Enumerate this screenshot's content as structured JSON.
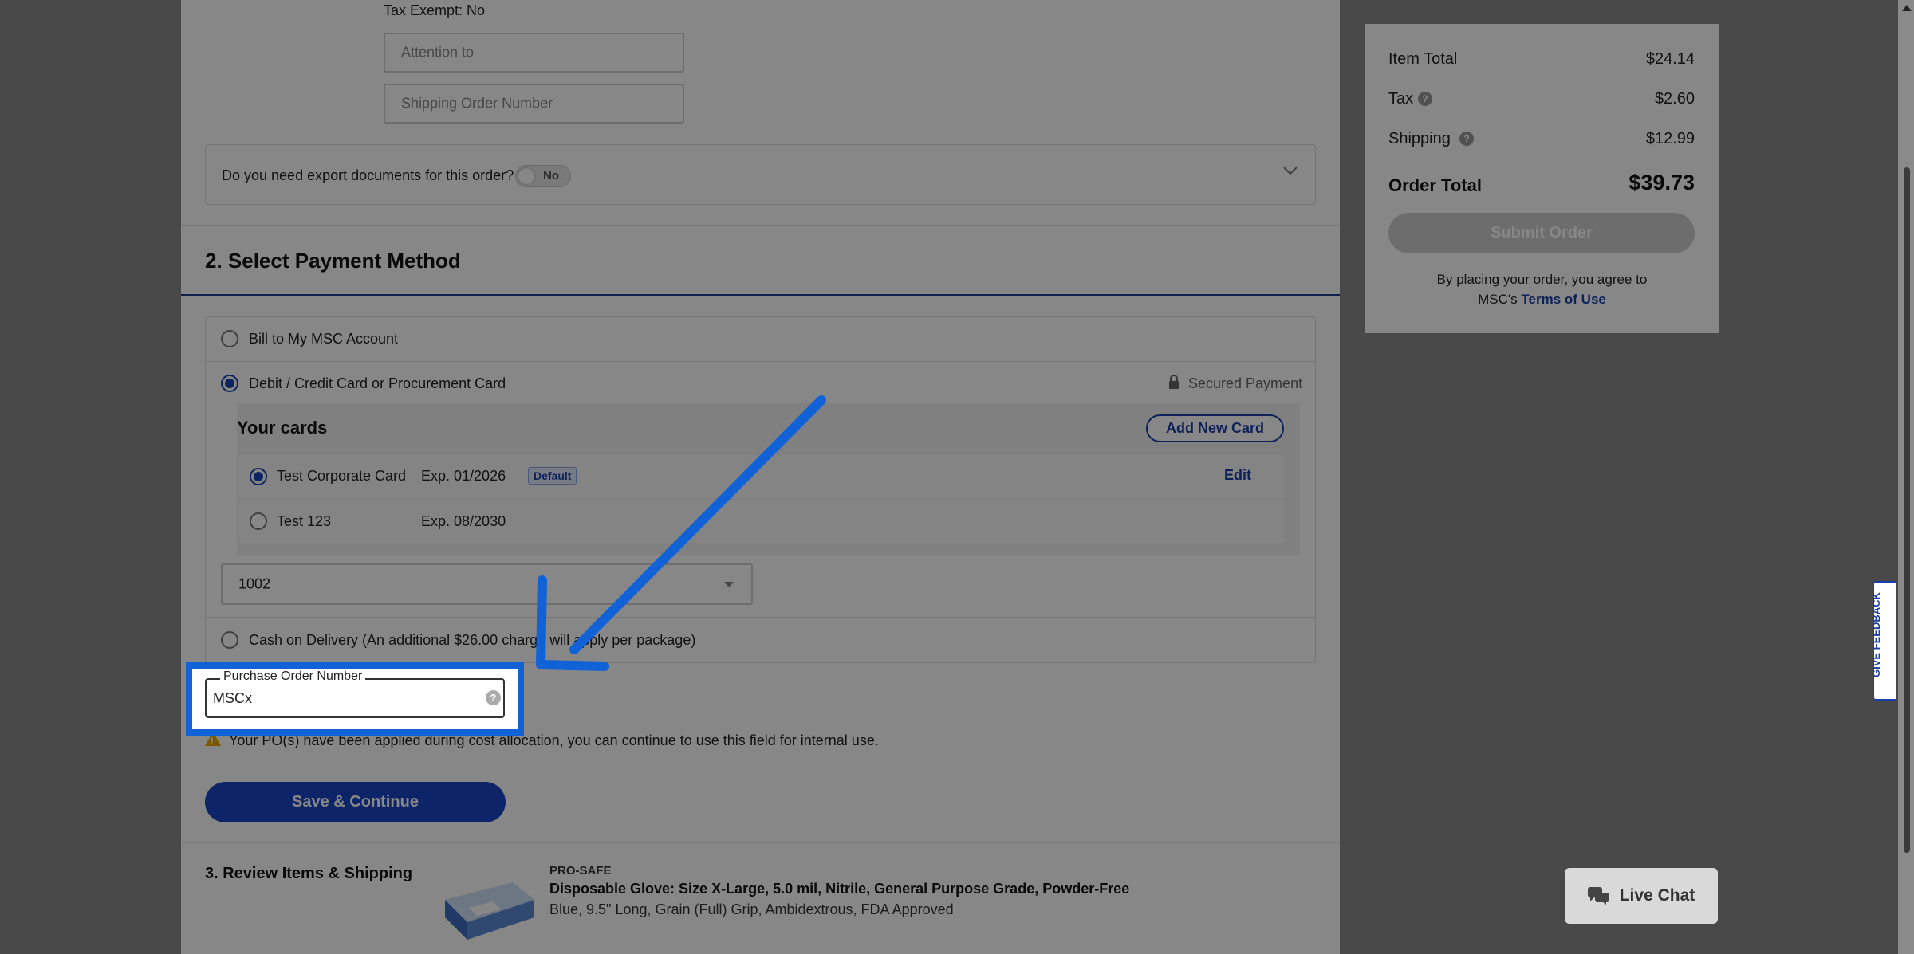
{
  "shipping": {
    "tax_exempt": "Tax Exempt: No",
    "attention_placeholder": "Attention to",
    "shipping_order_placeholder": "Shipping Order Number"
  },
  "export_docs": {
    "question": "Do you need export documents for this order?",
    "toggle_label": "No"
  },
  "payment": {
    "section_title": "2. Select Payment Method",
    "option_bill": "Bill to My MSC Account",
    "option_card": "Debit / Credit Card or Procurement Card",
    "secured": "Secured Payment",
    "your_cards_title": "Your cards",
    "add_card_label": "Add New Card",
    "cards": [
      {
        "name": "Test Corporate Card",
        "exp": "Exp. 01/2026",
        "badge": "Default",
        "edit": "Edit"
      },
      {
        "name": "Test 123",
        "exp": "Exp. 08/2030"
      }
    ],
    "selected_value": "1002",
    "option_cod": "Cash on Delivery (An additional $26.00 charge will apply per package)"
  },
  "po": {
    "label": "Purchase Order Number",
    "value": "MSCx",
    "help": "?",
    "notice": "Your PO(s) have been applied during cost allocation, you can continue to use this field for internal use."
  },
  "save_label": "Save & Continue",
  "review": {
    "title": "3. Review Items & Shipping",
    "brand": "PRO-SAFE",
    "product_title": "Disposable Glove: Size X-Large, 5.0 mil, Nitrile, General Purpose Grade, Powder-Free",
    "product_desc": "Blue, 9.5\" Long, Grain (Full) Grip, Ambidextrous, FDA Approved"
  },
  "summary": {
    "item_total_label": "Item Total",
    "item_total": "$24.14",
    "tax_label": "Tax",
    "tax": "$2.60",
    "shipping_label": "Shipping",
    "shipping": "$12.99",
    "order_total_label": "Order Total",
    "order_total": "$39.73",
    "submit_label": "Submit Order",
    "agree_text": "By placing your order, you agree to",
    "agree_text2": "MSC's",
    "terms_label": "Terms of Use"
  },
  "feedback_label": "GIVE FEEDBACK",
  "live_chat_label": "Live Chat",
  "colors": {
    "accent": "#1b45c4",
    "annotation_blue": "#1162d6",
    "overlay": "rgba(0,0,0,0.47)"
  }
}
